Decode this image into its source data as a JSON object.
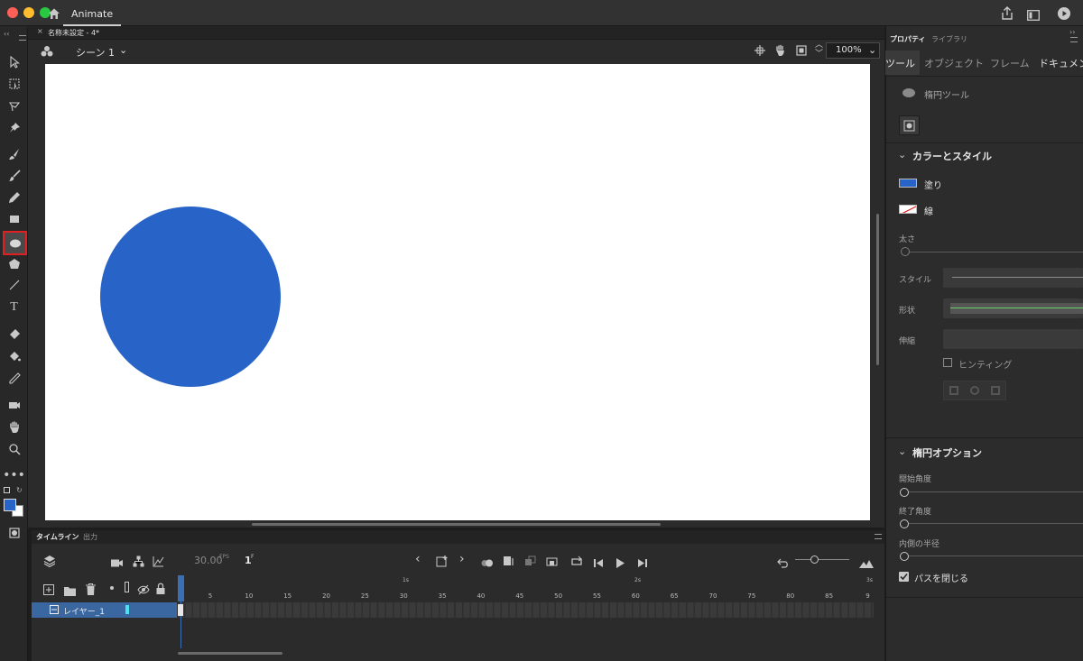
{
  "app": {
    "title": "Animate",
    "document_tab": "名称未設定 - 4*"
  },
  "scene": {
    "label": "シーン 1",
    "zoom": "100%"
  },
  "stage": {
    "circle_fill": "#2864c7"
  },
  "timeline": {
    "tab_timeline": "タイムライン",
    "tab_output": "出力",
    "fps": "30.00",
    "fps_unit": "FPS",
    "frame": "1",
    "frame_unit": "F",
    "ruler_numbers": [
      "5",
      "10",
      "15",
      "20",
      "25",
      "30",
      "35",
      "40",
      "45",
      "50",
      "55",
      "60",
      "65",
      "70",
      "75",
      "80",
      "85",
      "9"
    ],
    "ruler_seconds": [
      "1s",
      "2s",
      "3s"
    ],
    "layer_name": "レイヤー_1"
  },
  "properties": {
    "tab_properties": "プロパティ",
    "tab_library": "ライブラリ",
    "subtabs": [
      "ツール",
      "オブジェクト",
      "フレーム",
      "ドキュメント"
    ],
    "tool_name": "楕円ツール",
    "color_style_title": "カラーとスタイル",
    "fill_label": "塗り",
    "fill_color": "#2864c7",
    "stroke_label": "線",
    "thickness_label": "太さ",
    "style_label": "スタイル",
    "shape_label": "形状",
    "scale_label": "伸縮",
    "hinting_label": "ヒンティング",
    "ellipse_options_title": "楕円オプション",
    "start_angle_label": "開始角度",
    "end_angle_label": "終了角度",
    "inner_radius_label": "内側の半径",
    "close_path_label": "パスを閉じる",
    "close_path_checked": true
  }
}
